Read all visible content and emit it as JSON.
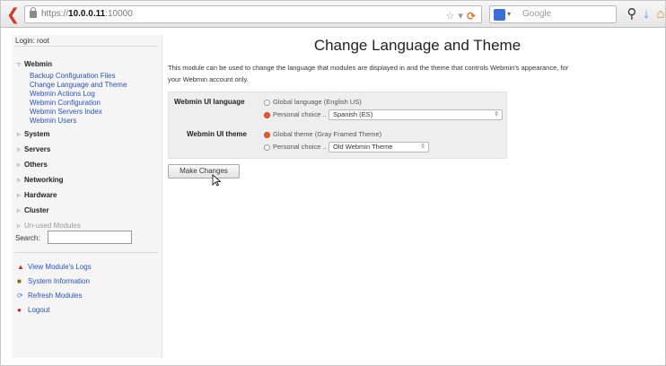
{
  "browser": {
    "url_scheme": "https://",
    "url_host": "10.0.0.11",
    "url_port": ":10000",
    "search_placeholder": "Google"
  },
  "sidebar": {
    "login": "Login: root",
    "webmin_category": "Webmin",
    "webmin_modules": [
      "Backup Configuration Files",
      "Change Language and Theme",
      "Webmin Actions Log",
      "Webmin Configuration",
      "Webmin Servers Index",
      "Webmin Users"
    ],
    "categories": [
      "System",
      "Servers",
      "Others",
      "Networking",
      "Hardware",
      "Cluster"
    ],
    "unused": "Un-used Modules",
    "search_label": "Search:",
    "links": [
      "View Module's Logs",
      "System Information",
      "Refresh Modules",
      "Logout"
    ]
  },
  "main": {
    "title": "Change Language and Theme",
    "description_line1": "This module can be used to change the language that modules are displayed in and the theme that controls Webmin's appearance, for",
    "description_line2": "your Webmin account only.",
    "language": {
      "label": "Webmin UI language",
      "global_option": "Global language (English US)",
      "personal_option": "Personal choice ..",
      "selected": "Spanish (ES)"
    },
    "theme": {
      "label": "Webmin UI theme",
      "global_option": "Global theme (Gray Framed Theme)",
      "personal_option": "Personal choice ..",
      "selected": "Old Webmin Theme"
    },
    "submit_label": "Make Changes"
  }
}
